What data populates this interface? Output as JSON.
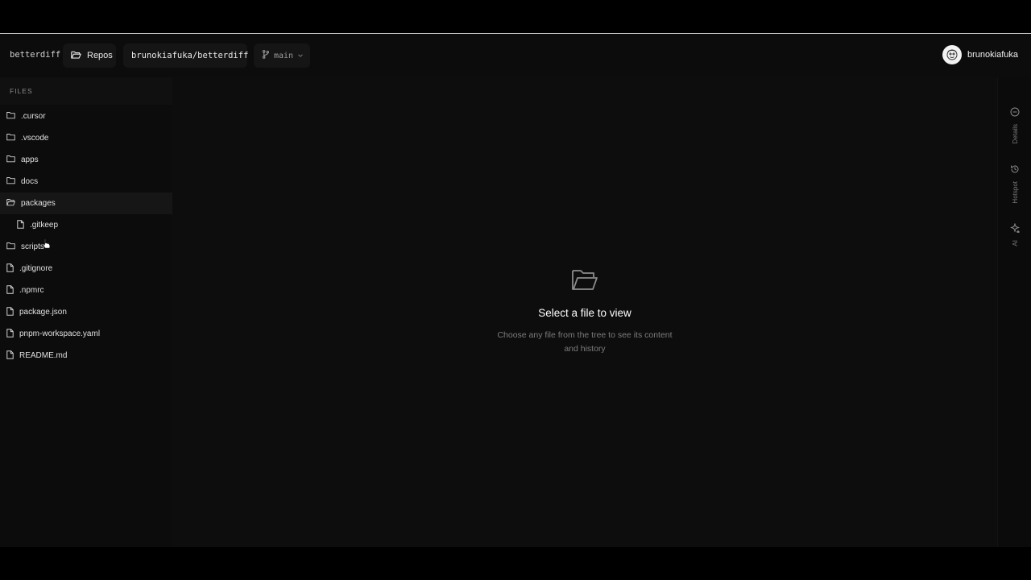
{
  "header": {
    "brand": "betterdiff",
    "repos_label": "Repos",
    "repo_name": "brunokiafuka/betterdiff",
    "branch": "main",
    "username": "brunokiafuka"
  },
  "sidebar": {
    "files_label": "FILES",
    "items": [
      {
        "label": ".cursor",
        "type": "folder"
      },
      {
        "label": ".vscode",
        "type": "folder"
      },
      {
        "label": "apps",
        "type": "folder"
      },
      {
        "label": "docs",
        "type": "folder"
      },
      {
        "label": "packages",
        "type": "folder-open"
      },
      {
        "label": ".gitkeep",
        "type": "file"
      },
      {
        "label": "scripts",
        "type": "folder"
      },
      {
        "label": ".gitignore",
        "type": "file"
      },
      {
        "label": ".npmrc",
        "type": "file"
      },
      {
        "label": "package.json",
        "type": "file"
      },
      {
        "label": "pnpm-workspace.yaml",
        "type": "file"
      },
      {
        "label": "README.md",
        "type": "file"
      }
    ]
  },
  "main": {
    "empty_title": "Select a file to view",
    "empty_desc_line1": "Choose any file from the tree to see its content",
    "empty_desc_line2": "and history"
  },
  "rail": {
    "details": "Details",
    "hotspot": "Hotspot",
    "ai": "AI"
  }
}
